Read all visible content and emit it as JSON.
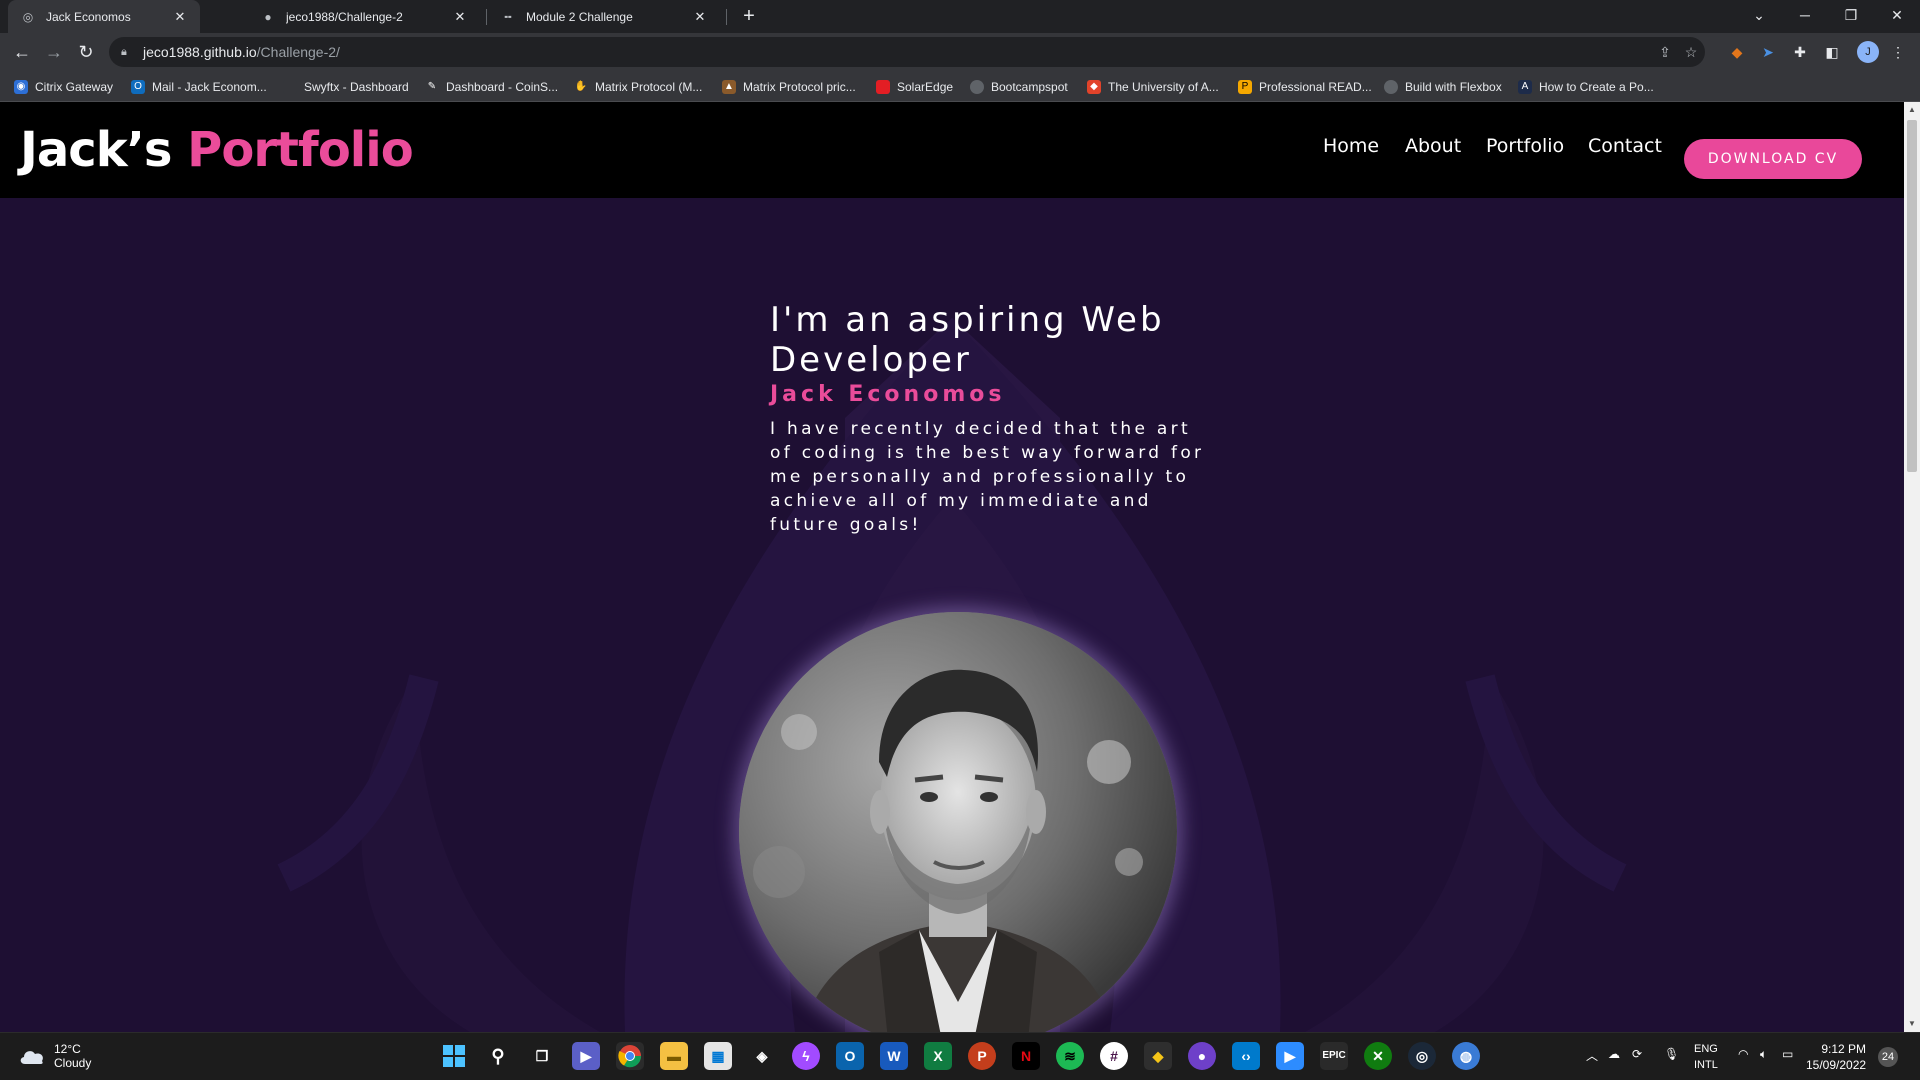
{
  "browser": {
    "tabs": [
      {
        "title": "Jack Economos",
        "active": true
      },
      {
        "title": "jeco1988/Challenge-2",
        "active": false
      },
      {
        "title": "Module 2 Challenge",
        "active": false
      }
    ],
    "new_tab_label": "+",
    "url_host": "jeco1988.github.io",
    "url_path": "/Challenge-2/",
    "profile_initial": "J",
    "bookmarks": [
      "Citrix Gateway",
      "Mail - Jack Econom...",
      "Swyftx - Dashboard",
      "Dashboard - CoinS...",
      "Matrix Protocol (M...",
      "Matrix Protocol pric...",
      "SolarEdge",
      "Bootcampspot",
      "The University of A...",
      "Professional READ...",
      "Build with Flexbox",
      "How to Create a Po..."
    ]
  },
  "site": {
    "brand_first": "Jack’s",
    "brand_second": "Portfolio",
    "nav": [
      "Home",
      "About",
      "Portfolio",
      "Contact"
    ],
    "cv_button": "DOWNLOAD CV",
    "hero_heading": "I'm an aspiring Web Developer",
    "hero_name": "Jack Economos",
    "hero_text": "I have recently decided that the art of coding is the best way forward for me personally and professionally to achieve all of my immediate and future goals!",
    "colors": {
      "accent": "#ea4c9a",
      "background": "#1e0f33",
      "header": "#000000"
    }
  },
  "taskbar": {
    "weather_temp": "12°C",
    "weather_desc": "Cloudy",
    "lang_line1": "ENG",
    "lang_line2": "INTL",
    "time": "9:12 PM",
    "date": "15/09/2022",
    "notifications": "24",
    "pinned_apps": [
      "windows-start",
      "search",
      "task-view",
      "teams",
      "chrome",
      "file-explorer",
      "store",
      "alienware",
      "messenger",
      "outlook",
      "word",
      "excel",
      "powerpoint",
      "netflix",
      "spotify",
      "slack",
      "git-kraken",
      "github",
      "vscode",
      "zoom",
      "epic-games",
      "xbox",
      "steam",
      "globe-app"
    ]
  }
}
